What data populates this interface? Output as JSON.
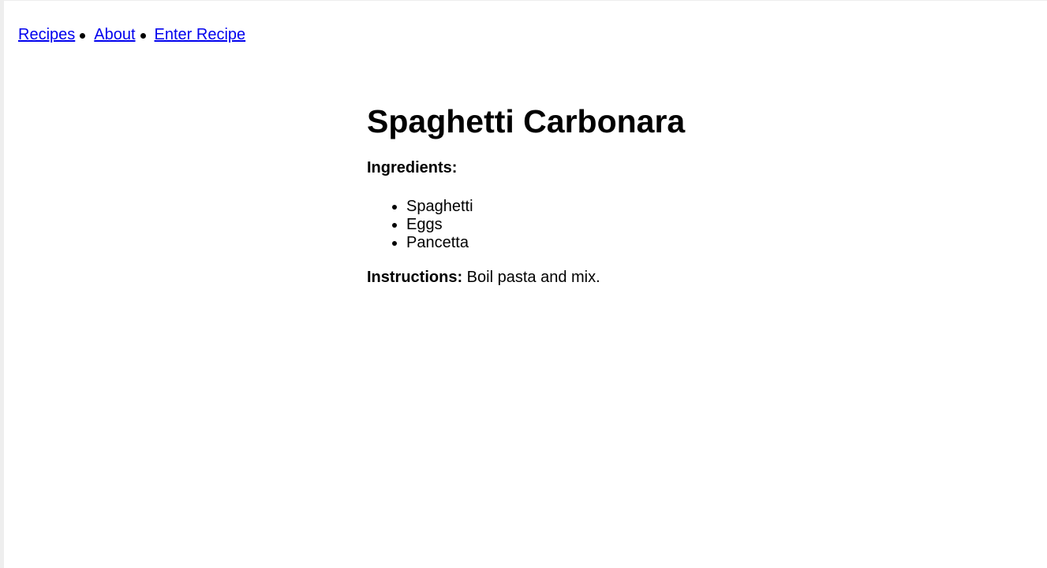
{
  "nav": {
    "links": [
      {
        "label": "Recipes"
      },
      {
        "label": "About"
      },
      {
        "label": "Enter Recipe"
      }
    ]
  },
  "recipe": {
    "title": "Spaghetti Carbonara",
    "ingredients_label": "Ingredients:",
    "ingredients": [
      "Spaghetti",
      "Eggs",
      "Pancetta"
    ],
    "instructions_label": "Instructions:",
    "instructions_text": " Boil pasta and mix."
  }
}
